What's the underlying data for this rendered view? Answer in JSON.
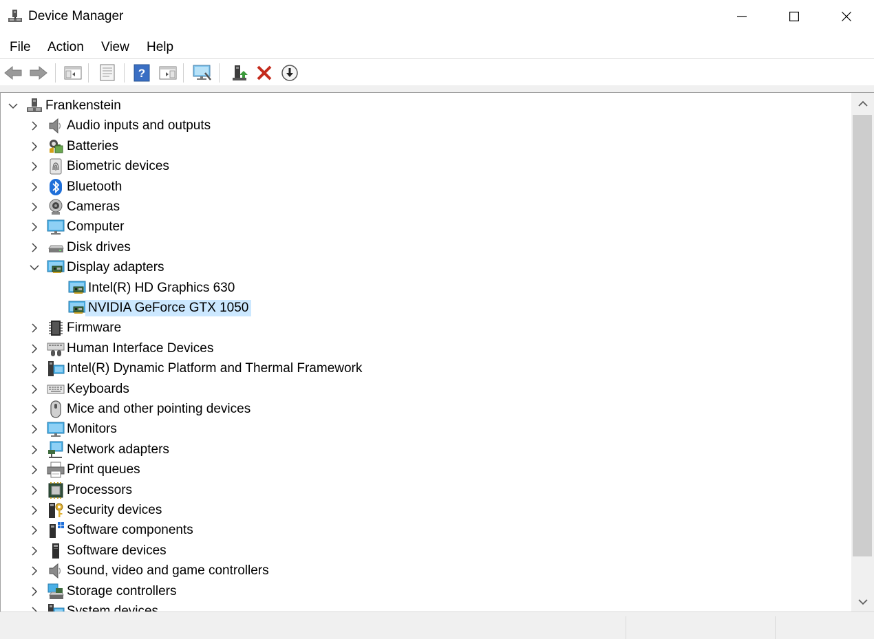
{
  "window": {
    "title": "Device Manager"
  },
  "menu": [
    "File",
    "Action",
    "View",
    "Help"
  ],
  "toolbar": {
    "buttons": [
      "back-icon",
      "forward-icon",
      "show-hide-console-tree-icon",
      "properties-icon",
      "help-icon",
      "show-action-pane-icon",
      "scan-hardware-icon",
      "update-driver-icon",
      "uninstall-device-icon",
      "disable-device-icon"
    ]
  },
  "tree": {
    "root": "Frankenstein",
    "categories": [
      {
        "label": "Audio inputs and outputs",
        "icon": "speaker-icon"
      },
      {
        "label": "Batteries",
        "icon": "battery-icon"
      },
      {
        "label": "Biometric devices",
        "icon": "fingerprint-icon"
      },
      {
        "label": "Bluetooth",
        "icon": "bluetooth-icon"
      },
      {
        "label": "Cameras",
        "icon": "camera-icon"
      },
      {
        "label": "Computer",
        "icon": "computer-icon"
      },
      {
        "label": "Disk drives",
        "icon": "disk-drive-icon"
      },
      {
        "label": "Display adapters",
        "icon": "display-adapter-icon",
        "expanded": true,
        "children": [
          {
            "label": "Intel(R) HD Graphics 630",
            "icon": "display-adapter-icon"
          },
          {
            "label": "NVIDIA GeForce GTX 1050",
            "icon": "display-adapter-icon",
            "selected": true
          }
        ]
      },
      {
        "label": "Firmware",
        "icon": "firmware-chip-icon"
      },
      {
        "label": "Human Interface Devices",
        "icon": "hid-icon"
      },
      {
        "label": "Intel(R) Dynamic Platform and Thermal Framework",
        "icon": "system-device-icon"
      },
      {
        "label": "Keyboards",
        "icon": "keyboard-icon"
      },
      {
        "label": "Mice and other pointing devices",
        "icon": "mouse-icon"
      },
      {
        "label": "Monitors",
        "icon": "monitor-icon"
      },
      {
        "label": "Network adapters",
        "icon": "network-adapter-icon"
      },
      {
        "label": "Print queues",
        "icon": "printer-icon"
      },
      {
        "label": "Processors",
        "icon": "processor-icon"
      },
      {
        "label": "Security devices",
        "icon": "security-device-icon"
      },
      {
        "label": "Software components",
        "icon": "software-component-icon"
      },
      {
        "label": "Software devices",
        "icon": "software-device-icon"
      },
      {
        "label": "Sound, video and game controllers",
        "icon": "speaker-icon"
      },
      {
        "label": "Storage controllers",
        "icon": "storage-controller-icon"
      },
      {
        "label": "System devices",
        "icon": "system-device-icon"
      }
    ]
  },
  "colors": {
    "selection": "#cce8ff",
    "scrollbar_track": "#f0f0f0",
    "scrollbar_thumb": "#cdcdcd",
    "uninstall_red": "#c42b1c"
  }
}
